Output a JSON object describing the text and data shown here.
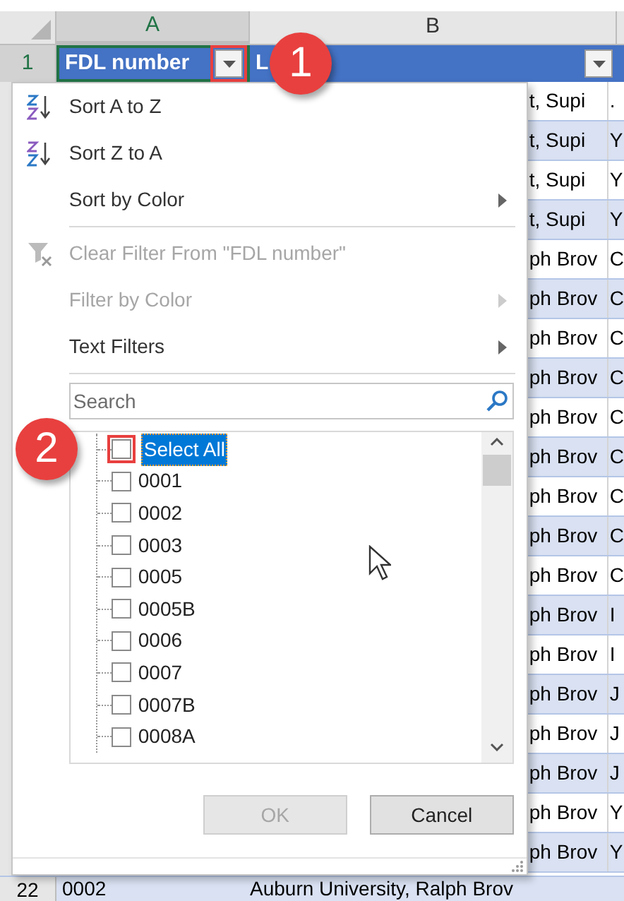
{
  "columns": [
    {
      "label": "A",
      "selected": true
    },
    {
      "label": "B",
      "selected": false
    }
  ],
  "header_row": {
    "row_number": "1",
    "cell_a": "FDL number",
    "cell_b": "L"
  },
  "menu": {
    "items": [
      {
        "kind": "sort_asc",
        "label": "Sort A to Z",
        "disabled": false,
        "submenu": false
      },
      {
        "kind": "sort_desc",
        "label": "Sort Z to A",
        "disabled": false,
        "submenu": false
      },
      {
        "kind": "plain",
        "label": "Sort by Color",
        "disabled": false,
        "submenu": true
      },
      {
        "kind": "separator"
      },
      {
        "kind": "clear_filter",
        "label": "Clear Filter From \"FDL number\"",
        "disabled": true,
        "submenu": false
      },
      {
        "kind": "plain",
        "label": "Filter by Color",
        "disabled": true,
        "submenu": true
      },
      {
        "kind": "plain",
        "label": "Text Filters",
        "disabled": false,
        "submenu": true
      },
      {
        "kind": "separator"
      }
    ],
    "search": {
      "placeholder": "Search"
    },
    "filter_list": [
      {
        "label": "Select All",
        "checked": false,
        "selected": true
      },
      {
        "label": "0001",
        "checked": false,
        "selected": false
      },
      {
        "label": "0002",
        "checked": false,
        "selected": false
      },
      {
        "label": "0003",
        "checked": false,
        "selected": false
      },
      {
        "label": "0005",
        "checked": false,
        "selected": false
      },
      {
        "label": "0005B",
        "checked": false,
        "selected": false
      },
      {
        "label": "0006",
        "checked": false,
        "selected": false
      },
      {
        "label": "0007",
        "checked": false,
        "selected": false
      },
      {
        "label": "0007B",
        "checked": false,
        "selected": false
      },
      {
        "label": "0008A",
        "checked": false,
        "selected": false
      }
    ],
    "buttons": [
      {
        "label": "OK",
        "disabled": true
      },
      {
        "label": "Cancel",
        "disabled": false
      }
    ]
  },
  "rows": [
    {
      "column_b": "t, Supi",
      "column_c": "."
    },
    {
      "column_b": "t, Supi",
      "column_c": "Y"
    },
    {
      "column_b": "t, Supi",
      "column_c": "Y"
    },
    {
      "column_b": "t, Supi",
      "column_c": "Y"
    },
    {
      "column_b": "ph Brov",
      "column_c": "C"
    },
    {
      "column_b": "ph Brov",
      "column_c": "C"
    },
    {
      "column_b": "ph Brov",
      "column_c": "C"
    },
    {
      "column_b": "ph Brov",
      "column_c": "C"
    },
    {
      "column_b": "ph Brov",
      "column_c": "C"
    },
    {
      "column_b": "ph Brov",
      "column_c": "C"
    },
    {
      "column_b": "ph Brov",
      "column_c": "C"
    },
    {
      "column_b": "ph Brov",
      "column_c": "C"
    },
    {
      "column_b": "ph Brov",
      "column_c": "C"
    },
    {
      "column_b": "ph Brov",
      "column_c": "I"
    },
    {
      "column_b": "ph Brov",
      "column_c": "I"
    },
    {
      "column_b": "ph Brov",
      "column_c": "J"
    },
    {
      "column_b": "ph Brov",
      "column_c": "J"
    },
    {
      "column_b": "ph Brov",
      "column_c": "J"
    },
    {
      "column_b": "ph Brov",
      "column_c": "Y"
    },
    {
      "column_b": "ph Brov",
      "column_c": "Y"
    }
  ],
  "bottom_row": {
    "row_number": "22",
    "cell_a": "0002",
    "cell_b": "Auburn University, Ralph Brov"
  },
  "callouts": [
    {
      "number": "1"
    },
    {
      "number": "2"
    }
  ]
}
